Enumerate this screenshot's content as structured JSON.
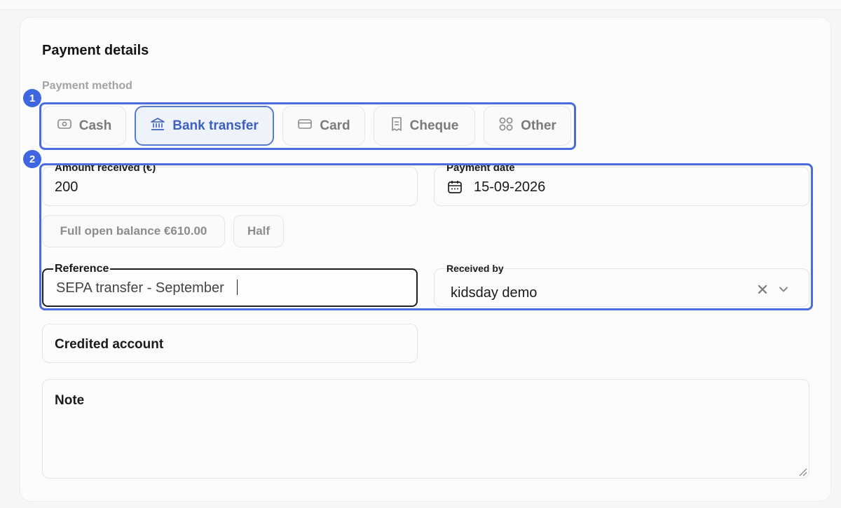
{
  "section": {
    "title": "Payment details",
    "method_label": "Payment method"
  },
  "methods": [
    {
      "label": "Cash",
      "icon": "cash-icon",
      "selected": false
    },
    {
      "label": "Bank transfer",
      "icon": "bank-icon",
      "selected": true
    },
    {
      "label": "Card",
      "icon": "card-icon",
      "selected": false
    },
    {
      "label": "Cheque",
      "icon": "cheque-icon",
      "selected": false
    },
    {
      "label": "Other",
      "icon": "grid-icon",
      "selected": false
    }
  ],
  "badges": [
    "1",
    "2"
  ],
  "amount": {
    "label": "Amount received (€)",
    "value": "200"
  },
  "payment_date": {
    "label": "Payment date",
    "value": "15-09-2026",
    "icon": "calendar-icon"
  },
  "quick_fill": {
    "full_balance": "Full open balance €610.00",
    "half": "Half"
  },
  "reference": {
    "label": "Reference",
    "value": "SEPA transfer - September"
  },
  "received_by": {
    "label": "Received by",
    "value": "kidsday demo",
    "clear_icon": "close-icon",
    "dropdown_icon": "chevron-down-icon"
  },
  "credited_account": {
    "label": "Credited account"
  },
  "note": {
    "label": "Note"
  },
  "colors": {
    "accent": "#3d66e0",
    "selected_text": "#3e5fc2",
    "highlight": "#4a6cdc"
  }
}
